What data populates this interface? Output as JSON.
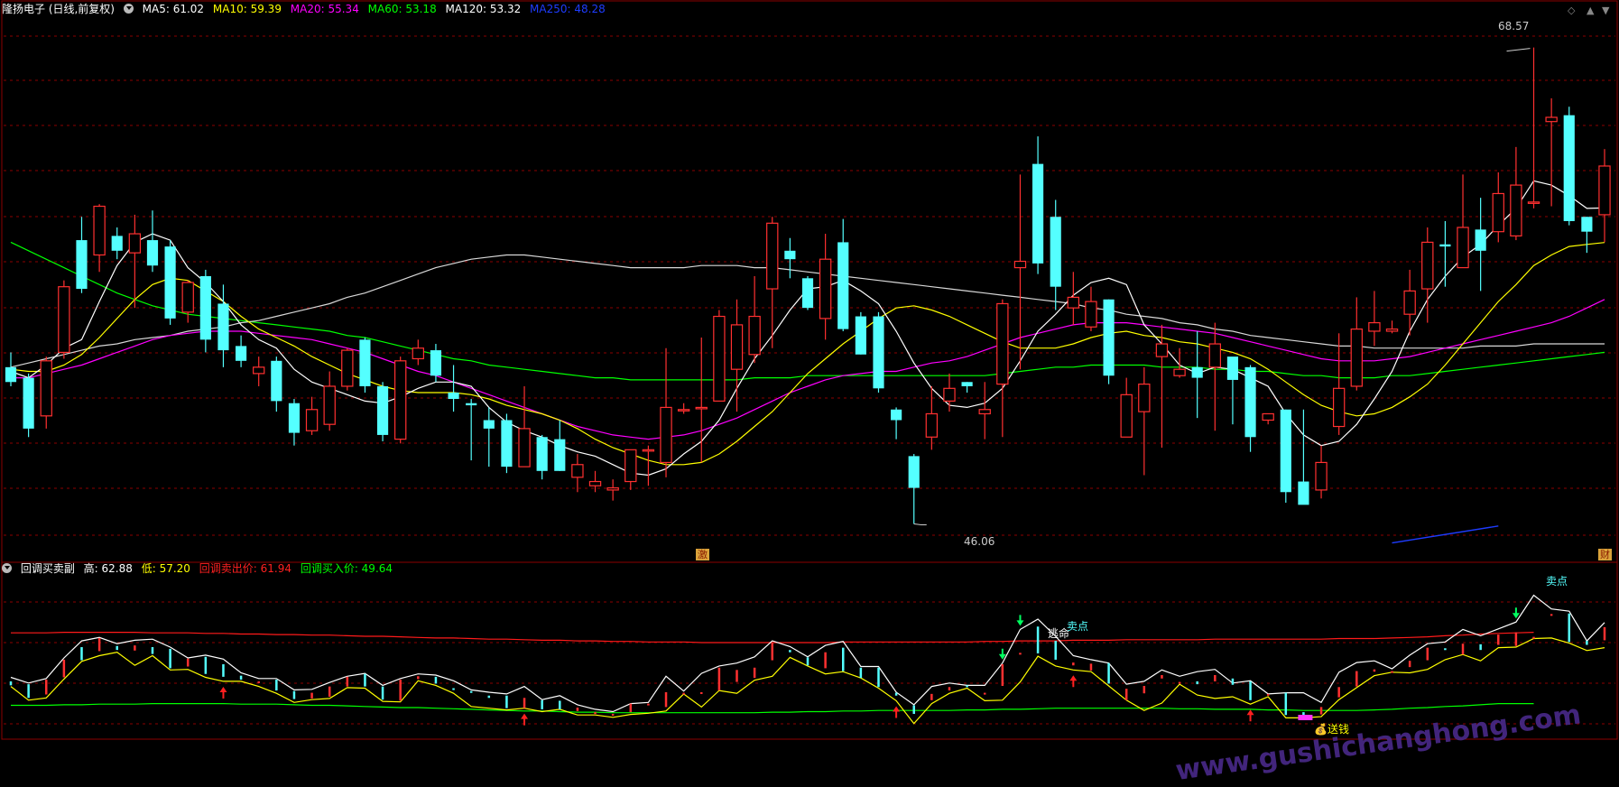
{
  "header": {
    "stock": "隆扬电子 (日线,前复权)",
    "ma": [
      {
        "label": "MA5: 61.02",
        "color": "#ffffff"
      },
      {
        "label": "MA10: 59.39",
        "color": "#ffff00"
      },
      {
        "label": "MA20: 55.34",
        "color": "#ff00ff"
      },
      {
        "label": "MA60: 53.18",
        "color": "#00ff00"
      },
      {
        "label": "MA120: 53.32",
        "color": "#ffffff"
      },
      {
        "label": "MA250: 48.28",
        "color": "#1e3cff"
      }
    ]
  },
  "sub_header": {
    "name": "回调买卖副",
    "items": [
      {
        "label": "高: 62.88",
        "color": "#ffffff"
      },
      {
        "label": "低: 57.20",
        "color": "#ffff00"
      },
      {
        "label": "回调卖出价: 61.94",
        "color": "#ff2020"
      },
      {
        "label": "回调买入价: 49.64",
        "color": "#00ff00"
      }
    ]
  },
  "annotations": {
    "high_value": "68.57",
    "low_value": "46.06",
    "badge_left": "激",
    "badge_right": "财",
    "sell_point_1": "卖点",
    "escape": "逃命",
    "sell_point_2": "卖点",
    "buy_money": "送钱"
  },
  "watermark": "www.gushichanghong.com",
  "colors": {
    "bg": "#000000",
    "grid": "#8b0000",
    "up": "#ff3030",
    "down": "#54ffff",
    "ma5": "#ffffff",
    "ma10": "#ffff00",
    "ma20": "#ff00ff",
    "ma60": "#00ff00",
    "ma120": "#d8d8d8",
    "ma250": "#1e3cff"
  },
  "chart_data": [
    {
      "type": "candlestick",
      "ylim": [
        44.5,
        70.5
      ],
      "x_count": 84,
      "candles": [
        [
          53.5,
          52.8,
          54.2,
          52.6
        ],
        [
          53.0,
          50.6,
          53.2,
          50.2
        ],
        [
          51.2,
          53.8,
          54.0,
          50.6
        ],
        [
          54.2,
          57.3,
          57.6,
          53.9
        ],
        [
          59.5,
          57.2,
          60.6,
          57.0
        ],
        [
          58.8,
          61.1,
          61.2,
          58.0
        ],
        [
          59.7,
          59.0,
          60.1,
          58.6
        ],
        [
          58.9,
          59.8,
          60.7,
          56.3
        ],
        [
          59.5,
          58.3,
          60.9,
          58.0
        ],
        [
          59.2,
          55.8,
          59.5,
          55.5
        ],
        [
          56.1,
          57.5,
          57.6,
          55.6
        ],
        [
          57.8,
          54.8,
          58.1,
          54.2
        ],
        [
          56.5,
          54.3,
          57.4,
          53.5
        ],
        [
          54.5,
          53.8,
          55.0,
          53.5
        ],
        [
          53.2,
          53.5,
          54.0,
          52.6
        ],
        [
          53.8,
          51.9,
          54.0,
          51.4
        ],
        [
          51.8,
          50.4,
          52.0,
          49.8
        ],
        [
          50.5,
          51.5,
          52.1,
          50.3
        ],
        [
          50.8,
          52.6,
          53.3,
          50.5
        ],
        [
          52.6,
          54.3,
          54.4,
          52.4
        ],
        [
          54.8,
          52.6,
          54.9,
          52.3
        ],
        [
          52.6,
          50.3,
          52.8,
          50.0
        ],
        [
          50.1,
          53.8,
          54.0,
          49.9
        ],
        [
          53.9,
          54.4,
          54.8,
          53.6
        ],
        [
          54.3,
          53.1,
          54.6,
          52.8
        ],
        [
          52.3,
          52.0,
          53.6,
          51.4
        ],
        [
          51.8,
          51.7,
          52.0,
          49.1
        ],
        [
          51.0,
          50.6,
          51.6,
          48.8
        ],
        [
          51.0,
          48.8,
          51.3,
          48.5
        ],
        [
          48.8,
          50.6,
          52.6,
          48.8
        ],
        [
          50.2,
          48.6,
          50.3,
          48.2
        ],
        [
          50.1,
          48.6,
          51.0,
          48.6
        ],
        [
          48.3,
          48.9,
          49.4,
          47.6
        ],
        [
          47.9,
          48.1,
          48.6,
          47.6
        ],
        [
          47.7,
          47.8,
          48.2,
          47.2
        ],
        [
          48.1,
          49.6,
          49.6,
          47.7
        ],
        [
          49.6,
          49.6,
          49.8,
          47.9
        ],
        [
          49.0,
          51.6,
          54.4,
          48.3
        ],
        [
          51.5,
          51.5,
          51.8,
          51.3
        ],
        [
          51.6,
          51.6,
          54.9,
          49.0
        ],
        [
          51.9,
          55.9,
          56.2,
          51.9
        ],
        [
          53.4,
          55.5,
          56.7,
          51.4
        ],
        [
          54.1,
          55.9,
          57.8,
          53.7
        ],
        [
          57.2,
          60.3,
          60.6,
          54.4
        ],
        [
          59.0,
          58.6,
          59.6,
          57.7
        ],
        [
          57.7,
          56.3,
          57.8,
          56.2
        ],
        [
          55.8,
          58.6,
          59.8,
          54.8
        ],
        [
          59.4,
          55.3,
          60.5,
          55.2
        ],
        [
          55.9,
          54.1,
          56.1,
          54.1
        ],
        [
          55.9,
          52.5,
          56.1,
          52.3
        ],
        [
          51.5,
          51.0,
          51.6,
          50.1
        ],
        [
          49.3,
          47.8,
          49.4,
          46.1
        ],
        [
          50.2,
          51.3,
          52.6,
          49.6
        ],
        [
          51.9,
          52.5,
          53.2,
          51.4
        ],
        [
          52.8,
          52.6,
          52.8,
          52.3
        ],
        [
          51.3,
          51.5,
          52.8,
          50.1
        ],
        [
          52.7,
          56.5,
          56.7,
          50.2
        ],
        [
          58.2,
          58.5,
          62.6,
          53.4
        ],
        [
          63.1,
          58.4,
          64.4,
          57.9
        ],
        [
          60.6,
          57.3,
          61.4,
          56.2
        ],
        [
          56.3,
          56.8,
          58.0,
          55.5
        ],
        [
          55.4,
          56.6,
          57.3,
          55.2
        ],
        [
          56.7,
          53.1,
          56.7,
          52.7
        ],
        [
          50.2,
          52.2,
          53.0,
          50.2
        ],
        [
          51.4,
          52.7,
          53.5,
          48.4
        ],
        [
          54.0,
          54.6,
          55.5,
          49.7
        ],
        [
          53.1,
          53.4,
          54.4,
          53.0
        ],
        [
          53.5,
          53.0,
          55.2,
          51.1
        ],
        [
          53.5,
          54.6,
          55.6,
          50.5
        ],
        [
          54.0,
          52.9,
          53.2,
          50.8
        ],
        [
          53.5,
          50.2,
          53.6,
          49.5
        ],
        [
          51.0,
          51.3,
          51.3,
          50.8
        ],
        [
          51.5,
          47.6,
          51.5,
          47.1
        ],
        [
          48.1,
          47.0,
          51.5,
          47.1
        ],
        [
          47.7,
          49.0,
          49.8,
          47.3
        ],
        [
          50.7,
          52.5,
          55.1,
          50.3
        ],
        [
          52.6,
          55.3,
          56.8,
          52.4
        ],
        [
          55.2,
          55.6,
          57.1,
          54.5
        ],
        [
          55.2,
          55.3,
          55.7,
          55.1
        ],
        [
          56.0,
          57.1,
          58.1,
          55.0
        ],
        [
          57.2,
          59.4,
          60.1,
          55.6
        ],
        [
          59.3,
          59.2,
          60.4,
          57.3
        ],
        [
          58.2,
          60.1,
          62.6,
          58.2
        ],
        [
          60.0,
          59.0,
          61.5,
          57.1
        ],
        [
          59.9,
          61.7,
          62.7,
          59.4
        ],
        [
          59.7,
          62.1,
          63.9,
          59.5
        ],
        [
          61.3,
          61.3,
          68.6,
          61.0
        ],
        [
          65.1,
          65.3,
          66.2,
          61.1
        ],
        [
          65.4,
          60.4,
          65.8,
          60.2
        ],
        [
          60.6,
          59.9,
          60.6,
          58.9
        ],
        [
          60.7,
          63.0,
          63.8,
          59.4
        ]
      ],
      "ma5": [
        53.3,
        53.0,
        53.6,
        54.4,
        54.8,
        56.6,
        58.3,
        59.4,
        59.8,
        59.5,
        58.2,
        57.5,
        56.6,
        55.5,
        54.8,
        54.4,
        53.4,
        52.8,
        52.5,
        52.2,
        51.9,
        51.8,
        52.1,
        52.5,
        52.8,
        52.8,
        52.6,
        51.6,
        50.9,
        50.5,
        50.2,
        49.8,
        49.5,
        49.3,
        48.9,
        48.5,
        48.4,
        48.7,
        49.4,
        50.0,
        51.0,
        52.5,
        53.9,
        55.0,
        56.2,
        57.2,
        57.3,
        57.6,
        57.1,
        56.5,
        55.2,
        53.7,
        52.5,
        51.7,
        51.6,
        51.8,
        52.5,
        53.8,
        55.2,
        56.0,
        56.9,
        57.5,
        57.7,
        57.4,
        55.5,
        54.6,
        53.6,
        53.2,
        53.5,
        53.4,
        53.0,
        52.6,
        51.3,
        50.3,
        49.8,
        50.0,
        50.8,
        52.0,
        53.3,
        55.2,
        56.7,
        57.8,
        58.7,
        59.3,
        60.2,
        61.0,
        62.3,
        62.1,
        61.6,
        61.0,
        61.02
      ],
      "ma10": [
        53.4,
        53.3,
        53.3,
        53.6,
        54.1,
        54.9,
        55.8,
        56.7,
        57.4,
        57.7,
        57.6,
        57.1,
        56.6,
        55.9,
        55.3,
        54.9,
        54.5,
        54.0,
        53.6,
        53.2,
        52.9,
        52.6,
        52.4,
        52.3,
        52.3,
        52.3,
        52.2,
        52.0,
        51.7,
        51.5,
        51.3,
        51.0,
        50.6,
        50.1,
        49.7,
        49.4,
        49.1,
        48.9,
        48.9,
        49.0,
        49.4,
        50.0,
        50.7,
        51.4,
        52.3,
        53.2,
        53.9,
        54.6,
        55.2,
        55.8,
        56.3,
        56.4,
        56.2,
        55.9,
        55.5,
        55.1,
        54.7,
        54.4,
        54.4,
        54.4,
        54.6,
        54.9,
        55.1,
        55.2,
        55.0,
        54.9,
        54.7,
        54.6,
        54.4,
        54.2,
        53.9,
        53.4,
        52.8,
        52.2,
        51.7,
        51.4,
        51.2,
        51.3,
        51.6,
        52.1,
        52.7,
        53.6,
        54.6,
        55.6,
        56.6,
        57.4,
        58.3,
        58.8,
        59.2,
        59.3,
        59.39
      ],
      "ma20": [
        53.0,
        53.0,
        53.2,
        53.4,
        53.6,
        53.9,
        54.2,
        54.5,
        54.8,
        55.0,
        55.1,
        55.2,
        55.2,
        55.2,
        55.1,
        55.0,
        54.9,
        54.8,
        54.6,
        54.4,
        54.2,
        53.9,
        53.6,
        53.3,
        53.1,
        52.8,
        52.5,
        52.2,
        51.9,
        51.6,
        51.3,
        51.0,
        50.7,
        50.5,
        50.3,
        50.2,
        50.1,
        50.2,
        50.3,
        50.5,
        50.8,
        51.1,
        51.5,
        51.9,
        52.3,
        52.6,
        52.9,
        53.1,
        53.2,
        53.3,
        53.3,
        53.5,
        53.7,
        53.8,
        54.0,
        54.3,
        54.6,
        54.9,
        55.1,
        55.3,
        55.5,
        55.6,
        55.6,
        55.6,
        55.5,
        55.4,
        55.3,
        55.2,
        55.1,
        54.9,
        54.7,
        54.5,
        54.3,
        54.1,
        53.9,
        53.8,
        53.8,
        53.8,
        53.9,
        54.0,
        54.2,
        54.4,
        54.6,
        54.8,
        55.0,
        55.2,
        55.4,
        55.6,
        55.9,
        56.3,
        56.7
      ],
      "ma60": [
        59.4,
        59.0,
        58.6,
        58.2,
        57.8,
        57.4,
        57.0,
        56.7,
        56.4,
        56.2,
        56.0,
        55.9,
        55.8,
        55.7,
        55.6,
        55.5,
        55.4,
        55.3,
        55.2,
        55.0,
        54.9,
        54.7,
        54.5,
        54.3,
        54.1,
        53.9,
        53.8,
        53.6,
        53.5,
        53.4,
        53.3,
        53.2,
        53.1,
        53.0,
        53.0,
        52.9,
        52.9,
        52.9,
        52.9,
        52.9,
        52.9,
        52.9,
        53.0,
        53.0,
        53.0,
        53.1,
        53.1,
        53.1,
        53.1,
        53.1,
        53.1,
        53.1,
        53.1,
        53.1,
        53.1,
        53.1,
        53.2,
        53.3,
        53.4,
        53.5,
        53.5,
        53.6,
        53.6,
        53.6,
        53.6,
        53.5,
        53.5,
        53.5,
        53.4,
        53.4,
        53.3,
        53.3,
        53.2,
        53.1,
        53.1,
        53.0,
        53.0,
        53.0,
        53.1,
        53.1,
        53.2,
        53.3,
        53.4,
        53.5,
        53.6,
        53.7,
        53.8,
        53.9,
        54.0,
        54.1,
        54.2
      ],
      "ma120": [
        53.5,
        53.7,
        53.9,
        54.1,
        54.3,
        54.5,
        54.6,
        54.8,
        54.9,
        55.0,
        55.2,
        55.3,
        55.4,
        55.6,
        55.7,
        55.9,
        56.1,
        56.3,
        56.5,
        56.8,
        57.0,
        57.3,
        57.6,
        57.9,
        58.2,
        58.4,
        58.6,
        58.7,
        58.8,
        58.8,
        58.7,
        58.6,
        58.5,
        58.4,
        58.3,
        58.2,
        58.2,
        58.2,
        58.2,
        58.3,
        58.3,
        58.3,
        58.2,
        58.2,
        58.1,
        58.0,
        57.9,
        57.8,
        57.7,
        57.6,
        57.5,
        57.4,
        57.3,
        57.2,
        57.1,
        57.0,
        56.9,
        56.8,
        56.7,
        56.6,
        56.5,
        56.3,
        56.2,
        56.0,
        55.9,
        55.8,
        55.6,
        55.5,
        55.3,
        55.2,
        55.0,
        54.9,
        54.8,
        54.7,
        54.6,
        54.5,
        54.5,
        54.4,
        54.4,
        54.4,
        54.4,
        54.4,
        54.4,
        54.5,
        54.5,
        54.5,
        54.6,
        54.6,
        54.6,
        54.6,
        54.6
      ],
      "ma250": [
        [
          78,
          45.2
        ],
        [
          84,
          46.0
        ]
      ]
    },
    {
      "type": "indicator",
      "ylim": [
        44.0,
        72.0
      ],
      "x_count": 84,
      "sell_line": [
        62.0,
        62.0,
        62.0,
        62.1,
        62.1,
        62.1,
        62.1,
        62.1,
        62.0,
        62.0,
        62.0,
        61.9,
        61.9,
        61.8,
        61.8,
        61.7,
        61.7,
        61.6,
        61.6,
        61.5,
        61.4,
        61.4,
        61.3,
        61.2,
        61.1,
        61.1,
        61.0,
        60.9,
        60.9,
        60.8,
        60.7,
        60.7,
        60.6,
        60.6,
        60.5,
        60.5,
        60.4,
        60.4,
        60.4,
        60.3,
        60.3,
        60.3,
        60.3,
        60.3,
        60.3,
        60.3,
        60.3,
        60.4,
        60.4,
        60.4,
        60.4,
        60.4,
        60.4,
        60.4,
        60.4,
        60.5,
        60.5,
        60.6,
        60.6,
        60.6,
        60.7,
        60.7,
        60.7,
        60.8,
        60.8,
        60.8,
        60.8,
        60.8,
        60.9,
        60.9,
        60.9,
        60.9,
        60.9,
        60.9,
        60.9,
        61.0,
        61.0,
        61.0,
        61.1,
        61.2,
        61.3,
        61.5,
        61.6,
        61.8,
        61.9,
        62.0,
        62.1
      ],
      "buy_line": [
        49.3,
        49.3,
        49.3,
        49.4,
        49.4,
        49.5,
        49.5,
        49.5,
        49.6,
        49.6,
        49.6,
        49.6,
        49.6,
        49.5,
        49.5,
        49.5,
        49.4,
        49.3,
        49.3,
        49.2,
        49.1,
        49.0,
        48.9,
        48.9,
        48.8,
        48.7,
        48.6,
        48.5,
        48.4,
        48.3,
        48.3,
        48.2,
        48.1,
        48.1,
        48.0,
        48.0,
        48.0,
        48.0,
        48.0,
        48.0,
        48.0,
        48.0,
        48.0,
        48.1,
        48.1,
        48.2,
        48.2,
        48.3,
        48.3,
        48.4,
        48.4,
        48.4,
        48.4,
        48.4,
        48.5,
        48.5,
        48.6,
        48.6,
        48.7,
        48.8,
        48.8,
        48.8,
        48.8,
        48.8,
        48.8,
        48.8,
        48.7,
        48.7,
        48.6,
        48.6,
        48.6,
        48.5,
        48.5,
        48.4,
        48.4,
        48.4,
        48.4,
        48.5,
        48.6,
        48.8,
        48.9,
        49.1,
        49.2,
        49.4,
        49.6,
        49.6,
        49.6
      ],
      "sell_marker_indices": [
        56,
        57,
        85
      ],
      "buy_arrow_indices": [
        12,
        29,
        50,
        60,
        70
      ],
      "money_index": 73
    }
  ]
}
